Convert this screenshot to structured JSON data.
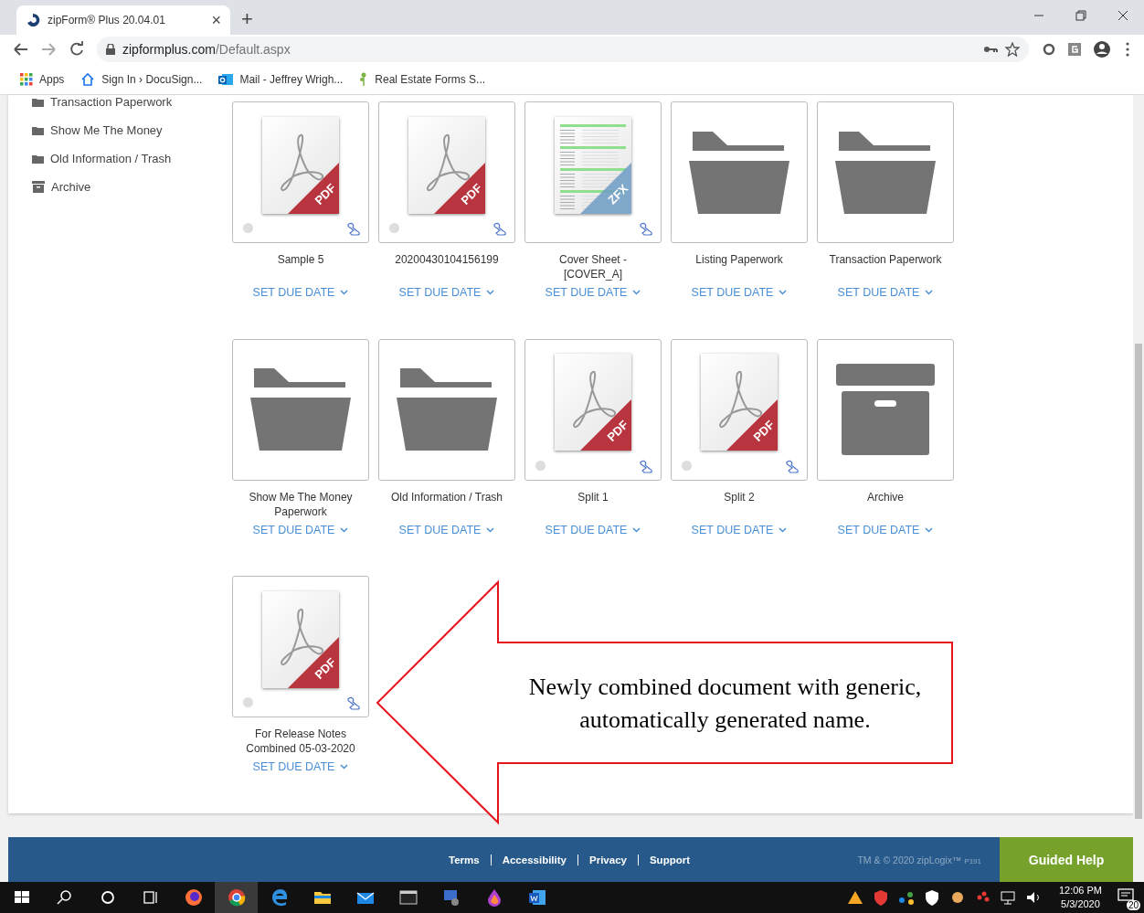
{
  "browser": {
    "tab_title": "zipForm® Plus 20.04.01",
    "tab_close": "×",
    "new_tab": "+",
    "url_domain": "zipformplus.com",
    "url_path": "/Default.aspx",
    "bookmarks": [
      {
        "label": "Apps",
        "kind": "apps"
      },
      {
        "label": "Sign In › DocuSign...",
        "kind": "home"
      },
      {
        "label": "Mail - Jeffrey Wrigh...",
        "kind": "mail"
      },
      {
        "label": "Real Estate Forms S...",
        "kind": "leaf"
      }
    ]
  },
  "sidebar": {
    "items": [
      {
        "label": "Transaction Paperwork",
        "kind": "folder"
      },
      {
        "label": "Show Me The Money",
        "kind": "folder"
      },
      {
        "label": "Old Information / Trash",
        "kind": "folder"
      },
      {
        "label": "Archive",
        "kind": "archive"
      }
    ]
  },
  "documents": [
    {
      "name": "Sample 5",
      "kind": "pdf",
      "badge": "PDF",
      "due_link": "SET DUE DATE"
    },
    {
      "name": "20200430104156199",
      "kind": "pdf",
      "badge": "PDF",
      "due_link": "SET DUE DATE"
    },
    {
      "name": "Cover Sheet - [COVER_A]",
      "kind": "zfx",
      "badge": "ZFX",
      "due_link": "SET DUE DATE"
    },
    {
      "name": "Listing Paperwork",
      "kind": "folder",
      "due_link": "SET DUE DATE"
    },
    {
      "name": "Transaction Paperwork",
      "kind": "folder",
      "due_link": "SET DUE DATE"
    },
    {
      "name": "Show Me The Money Paperwork",
      "kind": "folder",
      "due_link": "SET DUE DATE"
    },
    {
      "name": "Old Information / Trash",
      "kind": "folder",
      "due_link": "SET DUE DATE"
    },
    {
      "name": "Split 1",
      "kind": "pdf",
      "badge": "PDF",
      "due_link": "SET DUE DATE"
    },
    {
      "name": "Split 2",
      "kind": "pdf",
      "badge": "PDF",
      "due_link": "SET DUE DATE"
    },
    {
      "name": "Archive",
      "kind": "archive",
      "due_link": "SET DUE DATE"
    },
    {
      "name": "For Release Notes Combined 05-03-2020",
      "kind": "pdf",
      "badge": "PDF",
      "due_link": "SET DUE DATE"
    }
  ],
  "callout": {
    "text": "Newly combined document with generic, automatically generated name."
  },
  "footer": {
    "links": [
      "Terms",
      "Accessibility",
      "Privacy",
      "Support"
    ],
    "copyright": "TM & © 2020 zipLogix™",
    "code": "P191",
    "help_button": "Guided Help"
  },
  "taskbar": {
    "time": "12:06 PM",
    "date": "5/3/2020",
    "notifications": "20"
  }
}
